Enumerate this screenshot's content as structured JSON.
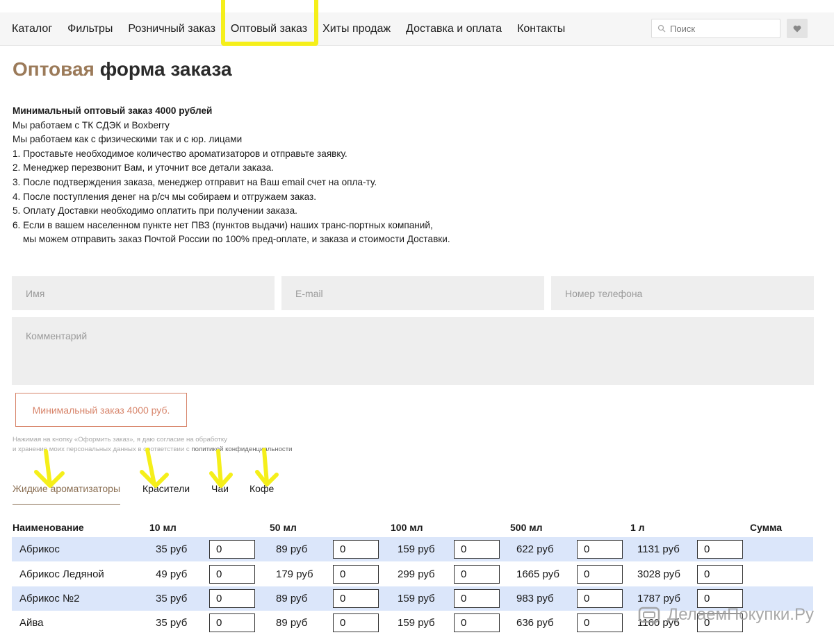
{
  "nav": {
    "items": [
      "Каталог",
      "Фильтры",
      "Розничный заказ",
      "Оптовый заказ",
      "Хиты продаж",
      "Доставка и оплата",
      "Контакты"
    ],
    "search_placeholder": "Поиск"
  },
  "page": {
    "title_accent": "Оптовая",
    "title_rest": "форма заказа"
  },
  "info": {
    "min_order": "Минимальный оптовый заказ 4000 рублей",
    "lines": [
      "Мы работаем с ТК СДЭК и Boxberry",
      "Мы работаем как с физическими так и с юр. лицами",
      "1. Проставьте необходимое количество ароматизаторов и отправьте заявку.",
      "2. Менеджер перезвонит Вам, и уточнит все детали заказа.",
      "3. После подтверждения заказа, менеджер отправит на Ваш email счет на опла-ту.",
      "4. После поступления денег на р/сч мы собираем и отгружаем заказ.",
      "5. Оплату Доставки необходимо оплатить при получении заказа.",
      "6. Если в вашем населенном пункте нет ПВЗ (пунктов выдачи) наших транс-портных компаний,"
    ],
    "last_line": "мы можем отправить заказ Почтой России по 100% пред-оплате, и заказа и стоимости Доставки."
  },
  "form": {
    "name_placeholder": "Имя",
    "email_placeholder": "E-mail",
    "phone_placeholder": "Номер телефона",
    "comment_placeholder": "Комментарий",
    "submit_label": "Минимальный заказ 4000 руб.",
    "consent_line1": "Нажимая на кнопку «Оформить заказ», я даю согласие на обработку",
    "consent_line2": "и хранение моих персональных данных в соответствии с",
    "consent_link": "политикой конфиденциальности"
  },
  "tabs": [
    "Жидкие ароматизаторы",
    "Красители",
    "Чаи",
    "Кофе"
  ],
  "table": {
    "headers": [
      "Наименование",
      "10 мл",
      "50 мл",
      "100 мл",
      "500 мл",
      "1 л",
      "Сумма"
    ],
    "rows": [
      {
        "name": "Абрикос",
        "prices": [
          "35 руб",
          "89 руб",
          "159 руб",
          "622 руб",
          "1131 руб"
        ],
        "qty": [
          "0",
          "0",
          "0",
          "0",
          "0"
        ]
      },
      {
        "name": "Абрикос Ледяной",
        "prices": [
          "49 руб",
          "179 руб",
          "299 руб",
          "1665 руб",
          "3028 руб"
        ],
        "qty": [
          "0",
          "0",
          "0",
          "0",
          "0"
        ]
      },
      {
        "name": "Абрикос №2",
        "prices": [
          "35 руб",
          "89 руб",
          "159 руб",
          "983 руб",
          "1787 руб"
        ],
        "qty": [
          "0",
          "0",
          "0",
          "0",
          "0"
        ]
      },
      {
        "name": "Айва",
        "prices": [
          "35 руб",
          "89 руб",
          "159 руб",
          "636 руб",
          "1160 руб"
        ],
        "qty": [
          "0",
          "0",
          "0",
          "0",
          "0"
        ]
      }
    ]
  },
  "watermark": "ДелаемПокупки.Ру",
  "colors": {
    "accent": "#9b7a59",
    "button": "#d7846a",
    "row_highlight": "#dbe6fa",
    "annotation": "#f5ef1a"
  }
}
